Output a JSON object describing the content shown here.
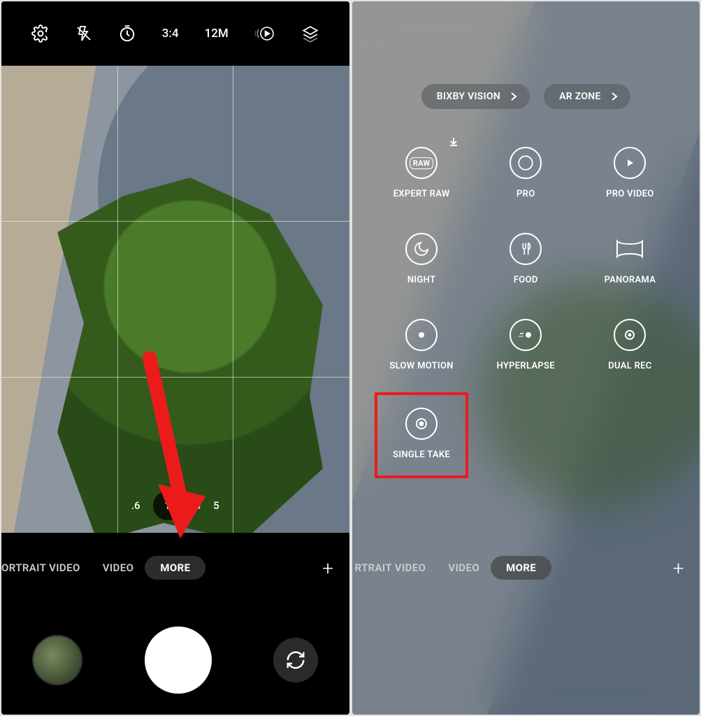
{
  "left": {
    "topbar": {
      "settings_icon": "settings-icon",
      "flash_icon": "flash-off-icon",
      "timer_icon": "timer-icon",
      "ratio": "3:4",
      "resolution": "12M",
      "motion_icon": "motion-photo-icon",
      "filters_icon": "filters-icon"
    },
    "zoom": {
      "v1": ".6",
      "v2": "1",
      "v3": "3",
      "v4": "5"
    },
    "modes": {
      "portrait_video": "PORTRAIT VIDEO",
      "video": "VIDEO",
      "more": "MORE"
    },
    "plus": "+"
  },
  "right": {
    "pills": {
      "bixby": "BIXBY VISION",
      "ar": "AR ZONE"
    },
    "modes_grid": {
      "expert_raw": "EXPERT RAW",
      "pro": "PRO",
      "pro_video": "PRO VIDEO",
      "night": "NIGHT",
      "food": "FOOD",
      "panorama": "PANORAMA",
      "slow_motion": "SLOW MOTION",
      "hyperlapse": "HYPERLAPSE",
      "dual_rec": "DUAL REC",
      "single_take": "SINGLE TAKE"
    },
    "modes": {
      "portrait_video": "RTRAIT VIDEO",
      "video": "VIDEO",
      "more": "MORE"
    },
    "plus": "+"
  }
}
